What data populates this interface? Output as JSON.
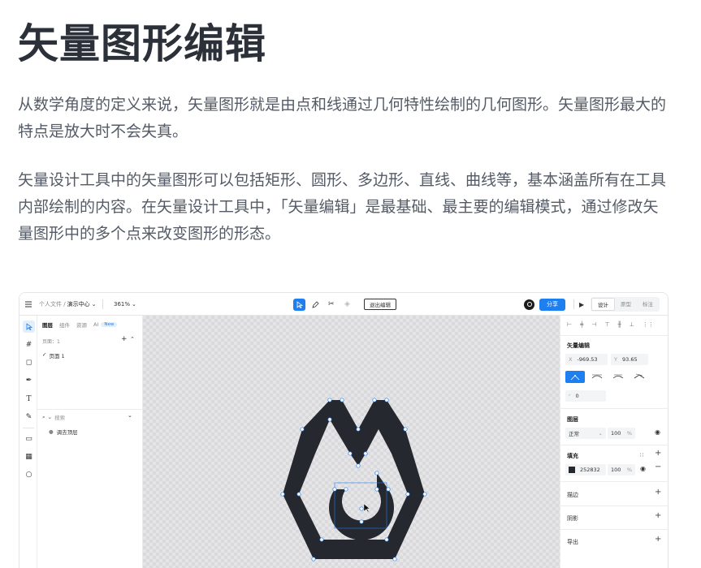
{
  "article": {
    "title": "矢量图形编辑",
    "para1": "从数学角度的定义来说，矢量图形就是由点和线通过几何特性绘制的几何图形。矢量图形最大的特点是放大时不会失真。",
    "para2": "矢量设计工具中的矢量图形可以包括矩形、圆形、多边形、直线、曲线等，基本涵盖所有在工具内部绘制的内容。在矢量设计工具中，「矢量编辑」是最基础、最主要的编辑模式，通过修改矢量图形中的多个点来改变图形的形态。"
  },
  "app": {
    "breadcrumb_prefix": "个人文件 /",
    "breadcrumb_current": "演示中心",
    "zoom": "361%",
    "exit_edit": "退出编辑",
    "share": "分享",
    "mode_tabs": [
      "设计",
      "原型",
      "标注"
    ],
    "left_tabs": [
      "图层",
      "组件",
      "资源",
      "AI"
    ],
    "ai_badge": "New",
    "pages_label": "页面：1",
    "page_item": "页面 1",
    "search_placeholder": "搜索",
    "layer_item": "调去顶层",
    "panel": {
      "vector_edit": "矢量编辑",
      "x_label": "X",
      "x_value": "-969.53",
      "y_label": "Y",
      "y_value": "93.65",
      "radius": "0",
      "layer": "图层",
      "blend": "正常",
      "opacity": "100",
      "percent": "%",
      "fill": "填充",
      "fill_hex": "252832",
      "fill_opacity": "100",
      "stroke": "描边",
      "shadow": "阴影",
      "export": "导出"
    },
    "colors": {
      "accent": "#1e7ff0",
      "shape": "#25282f"
    }
  }
}
